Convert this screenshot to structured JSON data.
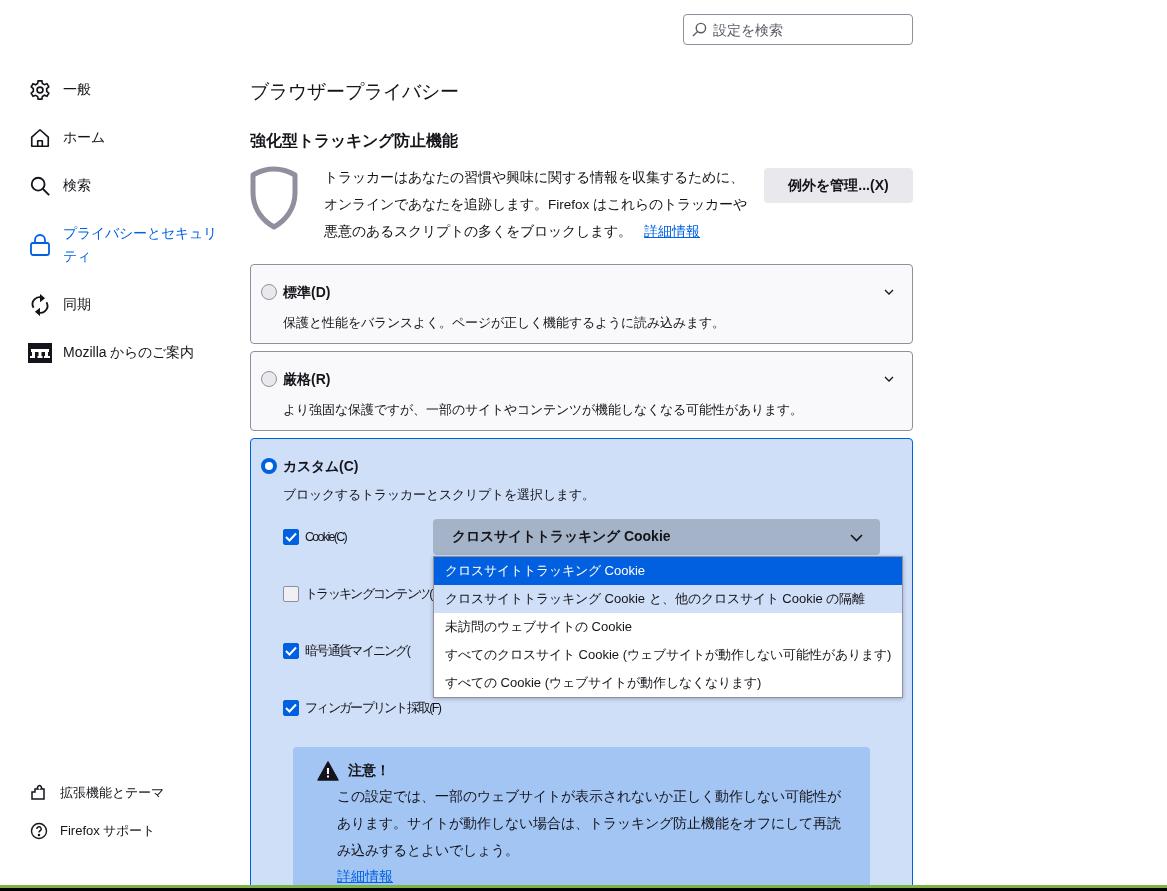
{
  "search": {
    "placeholder": "設定を検索"
  },
  "sidebar": {
    "items": [
      {
        "label": "一般",
        "selected": false
      },
      {
        "label": "ホーム",
        "selected": false
      },
      {
        "label": "検索",
        "selected": false
      },
      {
        "label": "プライバシーとセキュリティ",
        "selected": true
      },
      {
        "label": "同期",
        "selected": false
      },
      {
        "label": "Mozilla からのご案内",
        "selected": false
      }
    ],
    "footer_items": [
      {
        "label": "拡張機能とテーマ"
      },
      {
        "label": "Firefox サポート"
      }
    ]
  },
  "page_title": "ブラウザープライバシー",
  "section": {
    "title": "強化型トラッキング防止機能",
    "description": "トラッカーはあなたの習慣や興味に関する情報を収集するために、オンラインであなたを追跡します。Firefox はこれらのトラッカーや悪意のあるスクリプトの多くをブロックします。",
    "learn_more": "詳細情報",
    "manage_button": "例外を管理...(X)"
  },
  "presets": [
    {
      "label": "標準(D)",
      "description": "保護と性能をバランスよく。ページが正しく機能するように読み込みます。",
      "selected": false,
      "expanded": false
    },
    {
      "label": "厳格(R)",
      "description": "より強固な保護ですが、一部のサイトやコンテンツが機能しなくなる可能性があります。",
      "selected": false,
      "expanded": false
    },
    {
      "label": "カスタム(C)",
      "description": "ブロックするトラッカーとスクリプトを選択します。",
      "selected": true,
      "expanded": true
    }
  ],
  "custom_options": [
    {
      "label": "Cookie(C)",
      "checked": true
    },
    {
      "label": "トラッキングコンテンツ(",
      "checked": false
    },
    {
      "label": "暗号通貨マイニング(",
      "checked": true
    },
    {
      "label": "フィンガープリント採取(F)",
      "checked": true
    }
  ],
  "cookie_select": {
    "value": "クロスサイトトラッキング Cookie",
    "open": true,
    "options": [
      {
        "label": "クロスサイトトラッキング Cookie",
        "selected": true,
        "hovered": false
      },
      {
        "label": "クロスサイトトラッキング Cookie と、他のクロスサイト Cookie の隔離",
        "selected": false,
        "hovered": true
      },
      {
        "label": "未訪問のウェブサイトの Cookie",
        "selected": false,
        "hovered": false
      },
      {
        "label": "すべてのクロスサイト Cookie (ウェブサイトが動作しない可能性があります)",
        "selected": false,
        "hovered": false
      },
      {
        "label": "すべての Cookie (ウェブサイトが動作しなくなります)",
        "selected": false,
        "hovered": false
      }
    ]
  },
  "warning": {
    "title": "注意！",
    "text": "この設定では、一部のウェブサイトが表示されないか正しく動作しない可能性があります。サイトが動作しない場合は、トラッキング防止機能をオフにして再読み込みするとよいでしょう。",
    "link": "詳細情報"
  }
}
